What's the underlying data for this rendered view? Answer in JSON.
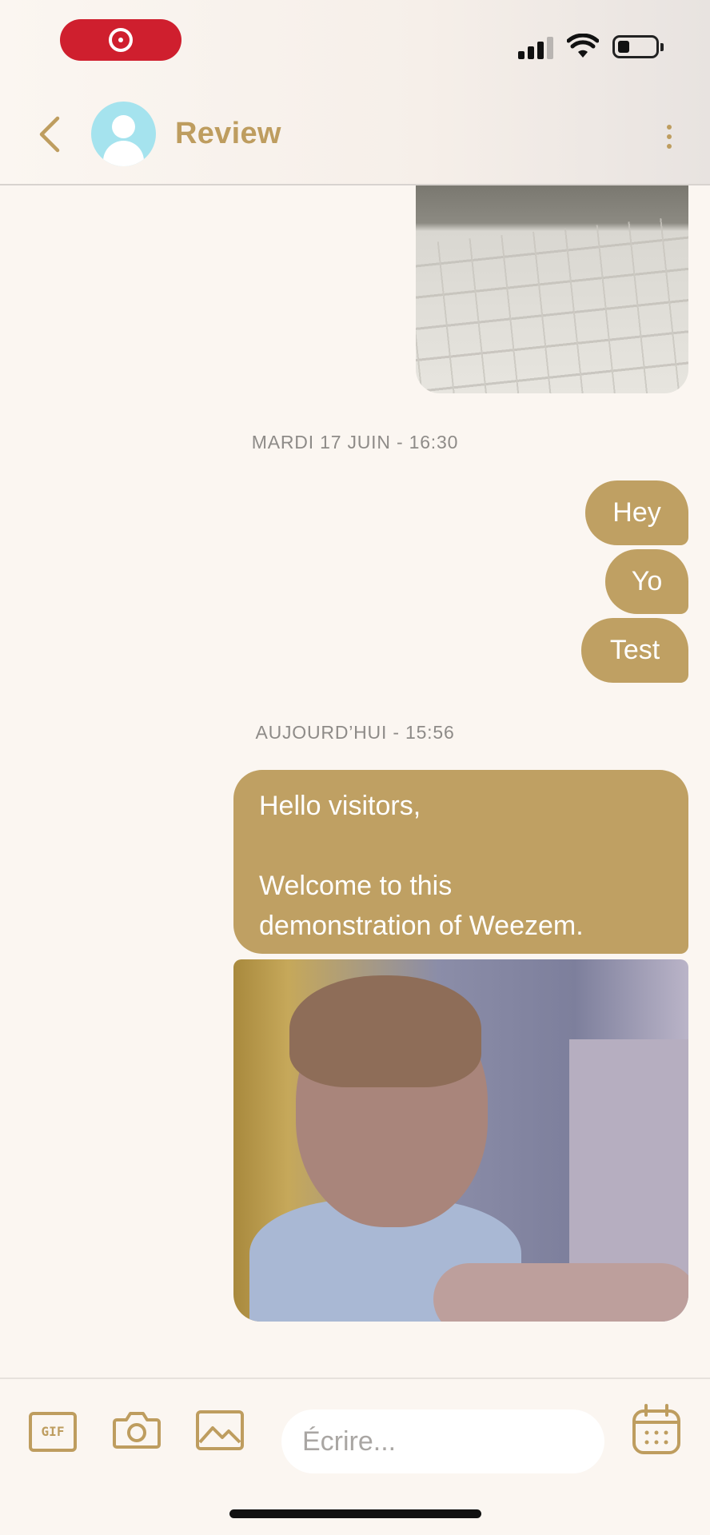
{
  "header": {
    "contact_name": "Review"
  },
  "chat": {
    "separators": [
      {
        "label": "MARDI 17 JUIN - 16:30"
      },
      {
        "label": "AUJOURD’HUI - 15:56"
      }
    ],
    "messages": [
      {
        "text": "Hey"
      },
      {
        "text": "Yo"
      },
      {
        "text": "Test"
      },
      {
        "text": "Hello visitors,\n\nWelcome to this\ndemonstration of Weezem."
      }
    ]
  },
  "composer": {
    "gif_label": "GIF",
    "placeholder": "Écrire..."
  },
  "colors": {
    "accent": "#be9d5f",
    "bubble": "#bfa063",
    "background": "#fbf6f1",
    "avatar": "#a5e3ee",
    "record_pill": "#cf1f2e"
  }
}
